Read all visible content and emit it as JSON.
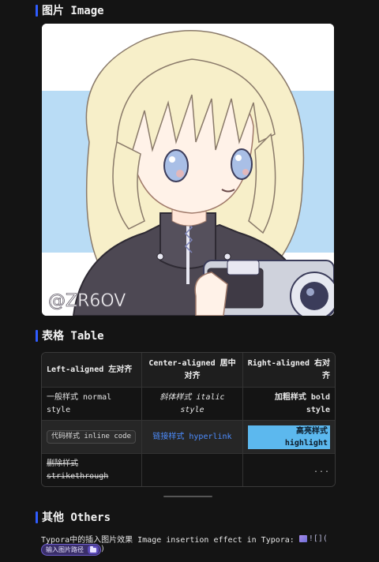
{
  "sections": {
    "image": {
      "title": "图片 Image"
    },
    "table": {
      "title": "表格 Table"
    },
    "others": {
      "title": "其他 Others"
    }
  },
  "illustration": {
    "subject": "anime girl with blonde bob haircut holding a camera",
    "signature": "@ZR6OV"
  },
  "table": {
    "headers": [
      "Left-aligned 左对齐",
      "Center-aligned 居中对齐",
      "Right-aligned 右对齐"
    ],
    "rows": [
      [
        "一般样式 normal style",
        "斜体样式 italic style",
        "加粗样式 bold style"
      ],
      [
        "代码样式 inline code",
        "链接样式 hyperlink",
        "高亮样式 highlight"
      ],
      [
        "删除样式 strikethrough",
        "",
        "..."
      ]
    ]
  },
  "others": {
    "text": "Typora中的插入图片效果 Image insertion effect in Typora:",
    "broken_image": "![](",
    "input_placeholder": "输入图片路径",
    "close_paren": ")"
  },
  "colors": {
    "accent_bar": "#2f5cff",
    "link": "#4d8dff",
    "highlight": "#5cb8ee",
    "input_pill": "#3a2f6a"
  }
}
